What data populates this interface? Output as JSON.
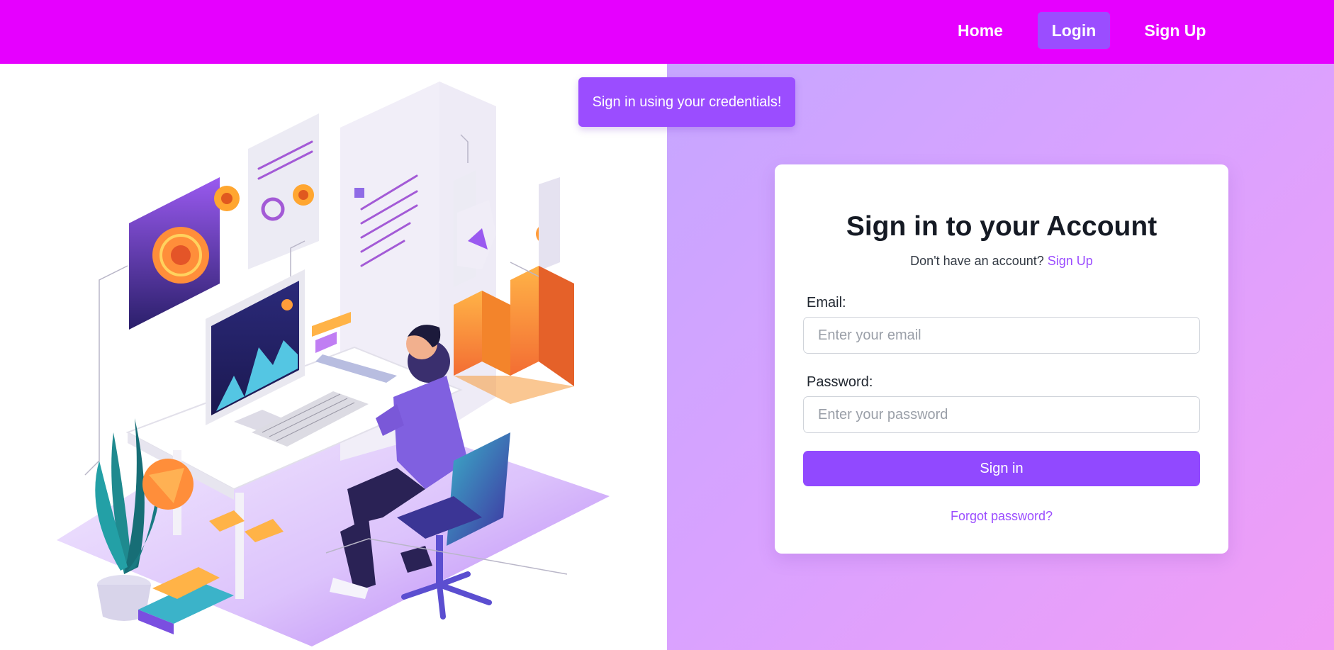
{
  "nav": {
    "home_label": "Home",
    "login_label": "Login",
    "signup_label": "Sign Up"
  },
  "toast": {
    "message": "Sign in using your credentials!"
  },
  "illustration": {
    "icon": "person-at-desk-illustration"
  },
  "signin_card": {
    "title": "Sign in to your Account",
    "subtitle_prefix": "Don't have an account?",
    "subtitle_link": "Sign Up",
    "email_label": "Email:",
    "email_value": "",
    "email_placeholder": "Enter your email",
    "password_label": "Password:",
    "password_value": "",
    "password_placeholder": "Enter your password",
    "submit_label": "Sign in",
    "forgot_label": "Forgot password?"
  },
  "colors": {
    "navbar": "#e600ff",
    "accent": "#9b4dff",
    "button": "#9149ff",
    "gradient_start": "#c6a6ff",
    "gradient_end": "#f19df6"
  }
}
